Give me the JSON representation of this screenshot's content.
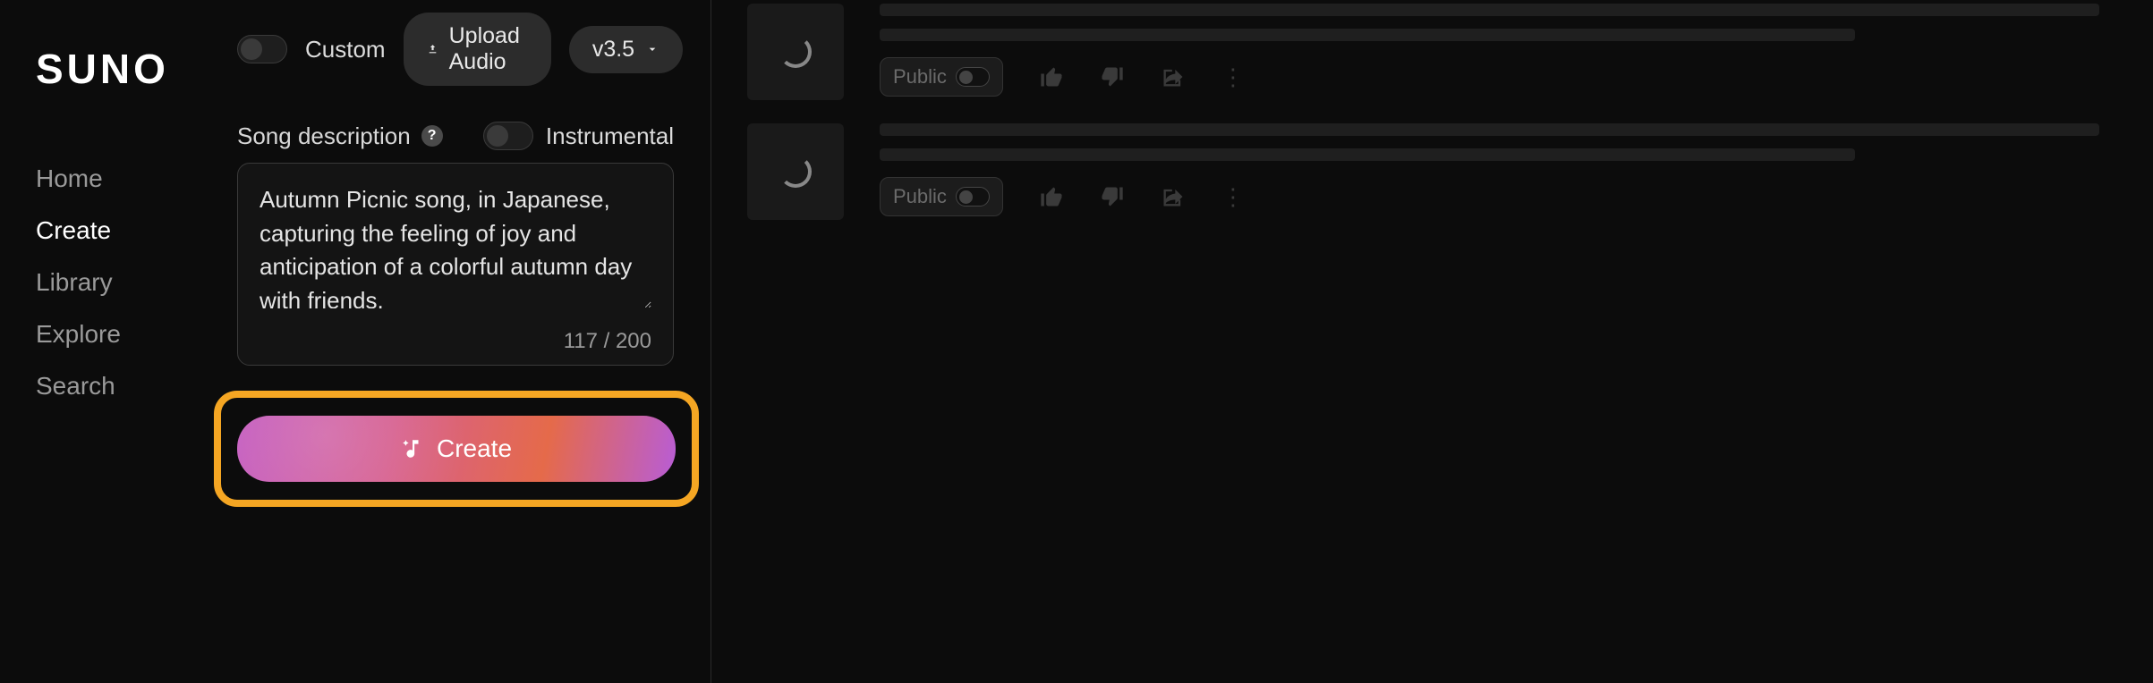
{
  "brand": "SUNO",
  "nav": {
    "items": [
      "Home",
      "Create",
      "Library",
      "Explore",
      "Search"
    ],
    "active": "Create"
  },
  "create": {
    "custom_label": "Custom",
    "upload_label": "Upload Audio",
    "version_label": "v3.5",
    "desc_label": "Song description",
    "instrumental_label": "Instrumental",
    "description_value": "Autumn Picnic song, in Japanese, capturing the feeling of joy and anticipation of a colorful autumn day with friends.",
    "counter": "117 / 200",
    "create_button": "Create"
  },
  "results": {
    "public_label": "Public",
    "items": [
      {
        "loading": true
      },
      {
        "loading": true
      }
    ]
  }
}
